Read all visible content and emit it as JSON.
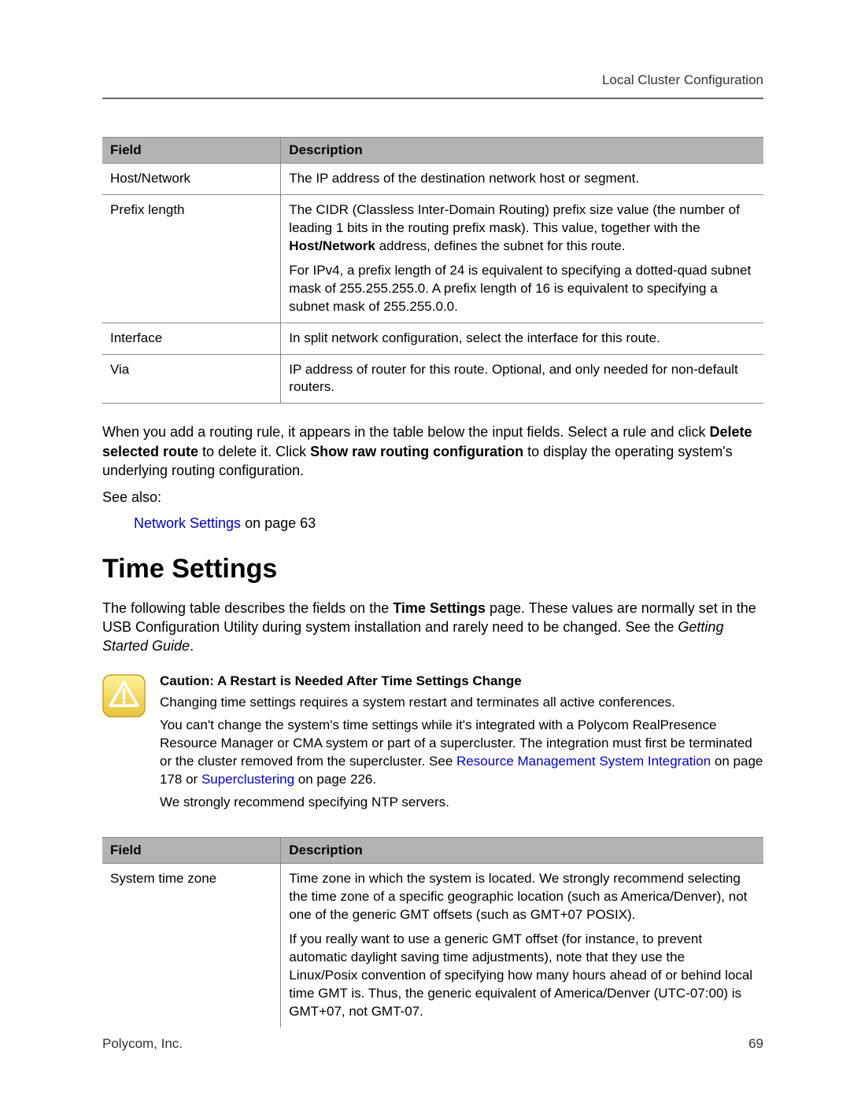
{
  "header": {
    "breadcrumb": "Local Cluster Configuration"
  },
  "table1": {
    "head_field": "Field",
    "head_desc": "Description",
    "rows": [
      {
        "field": "Host/Network",
        "desc_p1": "The IP address of the destination network host or segment."
      },
      {
        "field": "Prefix length",
        "desc_p1_pre": "The CIDR (Classless Inter-Domain Routing) prefix size value (the number of leading 1 bits in the routing prefix mask). This value, together with the ",
        "desc_p1_bold": "Host/Network",
        "desc_p1_post": " address, defines the subnet for this route.",
        "desc_p2": "For IPv4, a prefix length of 24 is equivalent to specifying a dotted-quad subnet mask of 255.255.255.0. A prefix length of 16 is equivalent to specifying a subnet mask of 255.255.0.0."
      },
      {
        "field": "Interface",
        "desc_p1": "In split network configuration, select the interface for this route."
      },
      {
        "field": "Via",
        "desc_p1": "IP address of router for this route. Optional, and only needed for non-default routers."
      }
    ]
  },
  "para_routing": {
    "t1": "When you add a routing rule, it appears in the table below the input fields. Select a rule and click ",
    "b1": "Delete selected route",
    "t2": " to delete it. Click ",
    "b2": "Show raw routing configuration",
    "t3": " to display the operating system's underlying routing configuration."
  },
  "see_also_label": "See also:",
  "see_also_link": {
    "link": "Network Settings",
    "tail": " on page 63"
  },
  "section_heading": "Time Settings",
  "intro_para": {
    "t1": "The following table describes the fields on the ",
    "b1": "Time Settings",
    "t2": " page. These values are normally set in the USB Configuration Utility during system installation and rarely need to be changed. See the ",
    "i1": "Getting Started Guide",
    "t3": "."
  },
  "caution": {
    "title": "Caution: A Restart is Needed After Time Settings Change",
    "p1": "Changing time settings requires a system restart and terminates all active conferences.",
    "p2_pre": "You can't change the system's time settings while it's integrated with a Polycom RealPresence Resource Manager or CMA system or part of a supercluster. The integration must first be terminated or the cluster removed from the supercluster. See ",
    "p2_link1": "Resource Management System Integration",
    "p2_mid": " on page 178 or ",
    "p2_link2": "Superclustering",
    "p2_post": " on page 226.",
    "p3": "We strongly recommend specifying NTP servers."
  },
  "table2": {
    "head_field": "Field",
    "head_desc": "Description",
    "row": {
      "field": "System time zone",
      "desc_p1": "Time zone in which the system is located. We strongly recommend selecting the time zone of a specific geographic location (such as America/Denver), not one of the generic GMT offsets (such as GMT+07 POSIX).",
      "desc_p2": "If you really want to use a generic GMT offset (for instance, to prevent automatic daylight saving time adjustments), note that they use the Linux/Posix convention of specifying how many hours ahead of or behind local time GMT is. Thus, the generic equivalent of America/Denver (UTC-07:00) is GMT+07, not GMT-07."
    }
  },
  "footer": {
    "company": "Polycom, Inc.",
    "page": "69"
  }
}
